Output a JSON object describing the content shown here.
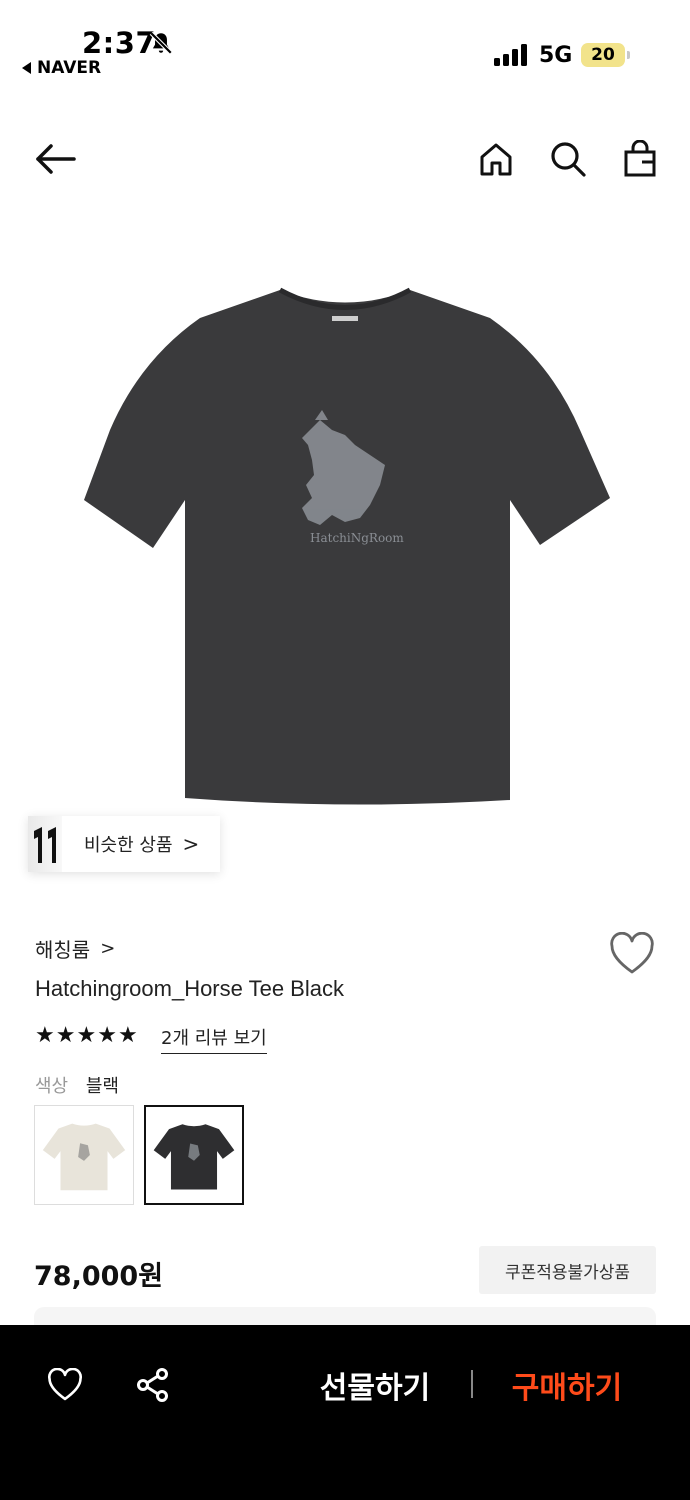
{
  "status_bar": {
    "time": "2:37",
    "back_app": "NAVER",
    "network": "5G",
    "battery": "20"
  },
  "nav": {
    "icons": [
      "back-arrow-icon",
      "home-icon",
      "search-icon",
      "shopping-bag-icon"
    ]
  },
  "similar": {
    "label": "비슷한 상품",
    "chevron": ">"
  },
  "product": {
    "brand": "해칭룸",
    "brand_chevron": ">",
    "name": "Hatchingroom_Horse Tee Black",
    "rating_stars": 5,
    "star_glyph": "★",
    "review_link": "2개 리뷰 보기",
    "color_label": "색상",
    "color_value": "블랙",
    "swatches": [
      {
        "color": "#e8e4da",
        "selected": false
      },
      {
        "color": "#2e2e30",
        "selected": true
      }
    ],
    "shirt_color": "#3a3a3c",
    "print_color": "#8a8e94",
    "price": "78,000원",
    "coupon_badge": "쿠폰적용불가상품"
  },
  "bottom_bar": {
    "gift_label": "선물하기",
    "buy_label": "구매하기",
    "buy_color": "#ff4b1a"
  }
}
